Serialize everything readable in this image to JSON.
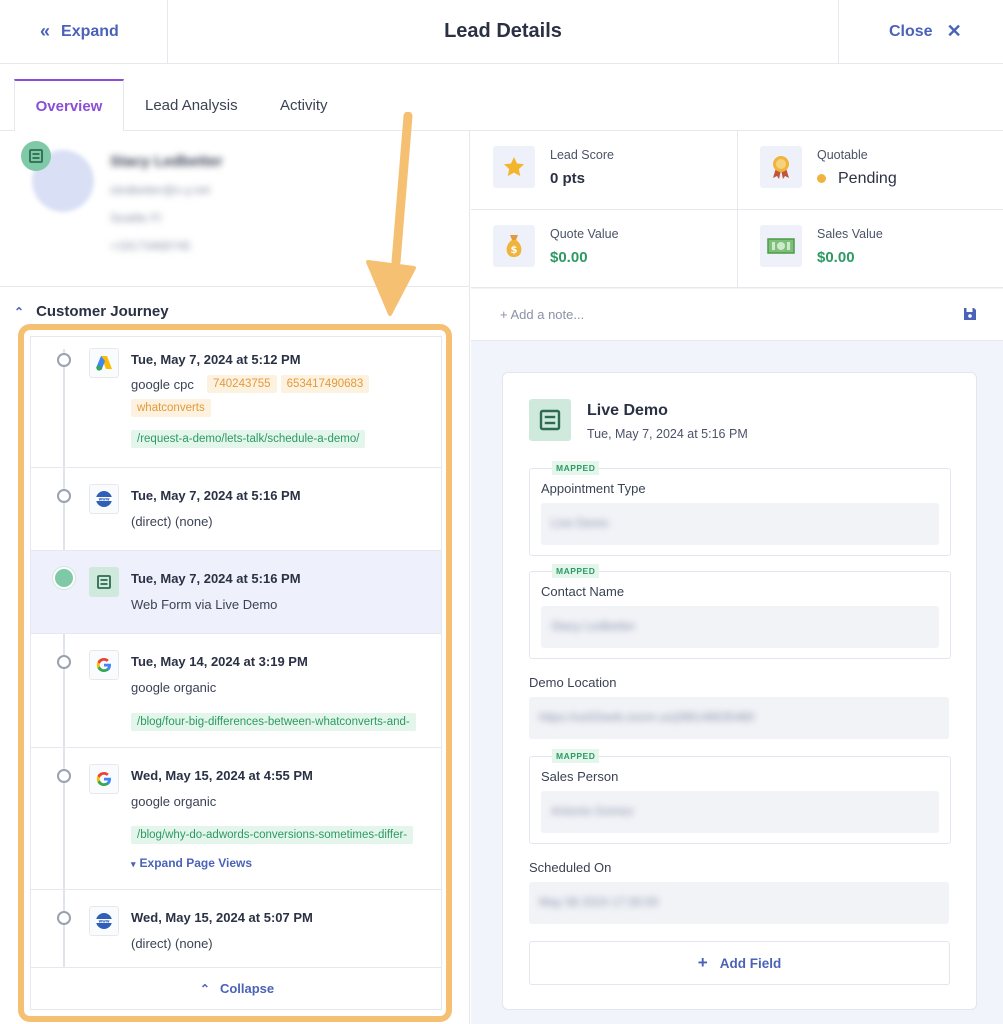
{
  "header": {
    "expand_label": "Expand",
    "title": "Lead Details",
    "close_label": "Close"
  },
  "tabs": [
    {
      "label": "Overview",
      "active": true
    },
    {
      "label": "Lead Analysis",
      "active": false
    },
    {
      "label": "Activity",
      "active": false
    }
  ],
  "profile": {
    "name": "Stacy Ledbetter",
    "email": "sledbetter@x-y.net",
    "company": "Seattle FI",
    "phone": "+19173468745"
  },
  "journey": {
    "heading": "Customer Journey",
    "entries": [
      {
        "date": "Tue, May 7, 2024 at 5:12 PM",
        "source": "google cpc",
        "icon": "google-ads-icon",
        "tags": [
          "740243755",
          "653417490683",
          "whatconverts"
        ],
        "path": "/request-a-demo/lets-talk/schedule-a-demo/"
      },
      {
        "date": "Tue, May 7, 2024 at 5:16 PM",
        "source": "(direct) (none)",
        "icon": "www-icon"
      },
      {
        "date": "Tue, May 7, 2024 at 5:16 PM",
        "source": "Web Form via Live Demo",
        "icon": "web-form-icon",
        "active": true
      },
      {
        "date": "Tue, May 14, 2024 at 3:19 PM",
        "source": "google organic",
        "icon": "google-icon",
        "path": "/blog/four-big-differences-between-whatconverts-and-"
      },
      {
        "date": "Wed, May 15, 2024 at 4:55 PM",
        "source": "google organic",
        "icon": "google-icon",
        "path": "/blog/why-do-adwords-conversions-sometimes-differ-",
        "expand_label": "Expand Page Views"
      },
      {
        "date": "Wed, May 15, 2024 at 5:07 PM",
        "source": "(direct) (none)",
        "icon": "www-icon"
      }
    ],
    "collapse_label": "Collapse"
  },
  "stats": {
    "lead_score": {
      "label": "Lead Score",
      "value": "0 pts"
    },
    "quotable": {
      "label": "Quotable",
      "value": "Pending",
      "dot_color": "#f0b33c"
    },
    "quote_value": {
      "label": "Quote Value",
      "value": "$0.00"
    },
    "sales_value": {
      "label": "Sales Value",
      "value": "$0.00"
    }
  },
  "note": {
    "placeholder": "+ Add a note..."
  },
  "card": {
    "title": "Live Demo",
    "date": "Tue, May 7, 2024 at 5:16 PM",
    "mapped_label": "MAPPED",
    "fields": {
      "appointment_type": {
        "label": "Appointment Type",
        "value": "Live Demo"
      },
      "contact_name": {
        "label": "Contact Name",
        "value": "Stacy Ledbetter"
      },
      "demo_location": {
        "label": "Demo Location",
        "value": "https://us02web.zoom.us/j/88148635480"
      },
      "sales_person": {
        "label": "Sales Person",
        "value": "Antonio Gomez"
      },
      "scheduled_on": {
        "label": "Scheduled On",
        "value": "May 08 2024 17:30:00"
      }
    },
    "add_field_label": "Add Field"
  },
  "colors": {
    "accent": "#4a63b8",
    "tab_active": "#8b4fd6",
    "highlight": "#f5c072",
    "green": "#2c9a62"
  }
}
